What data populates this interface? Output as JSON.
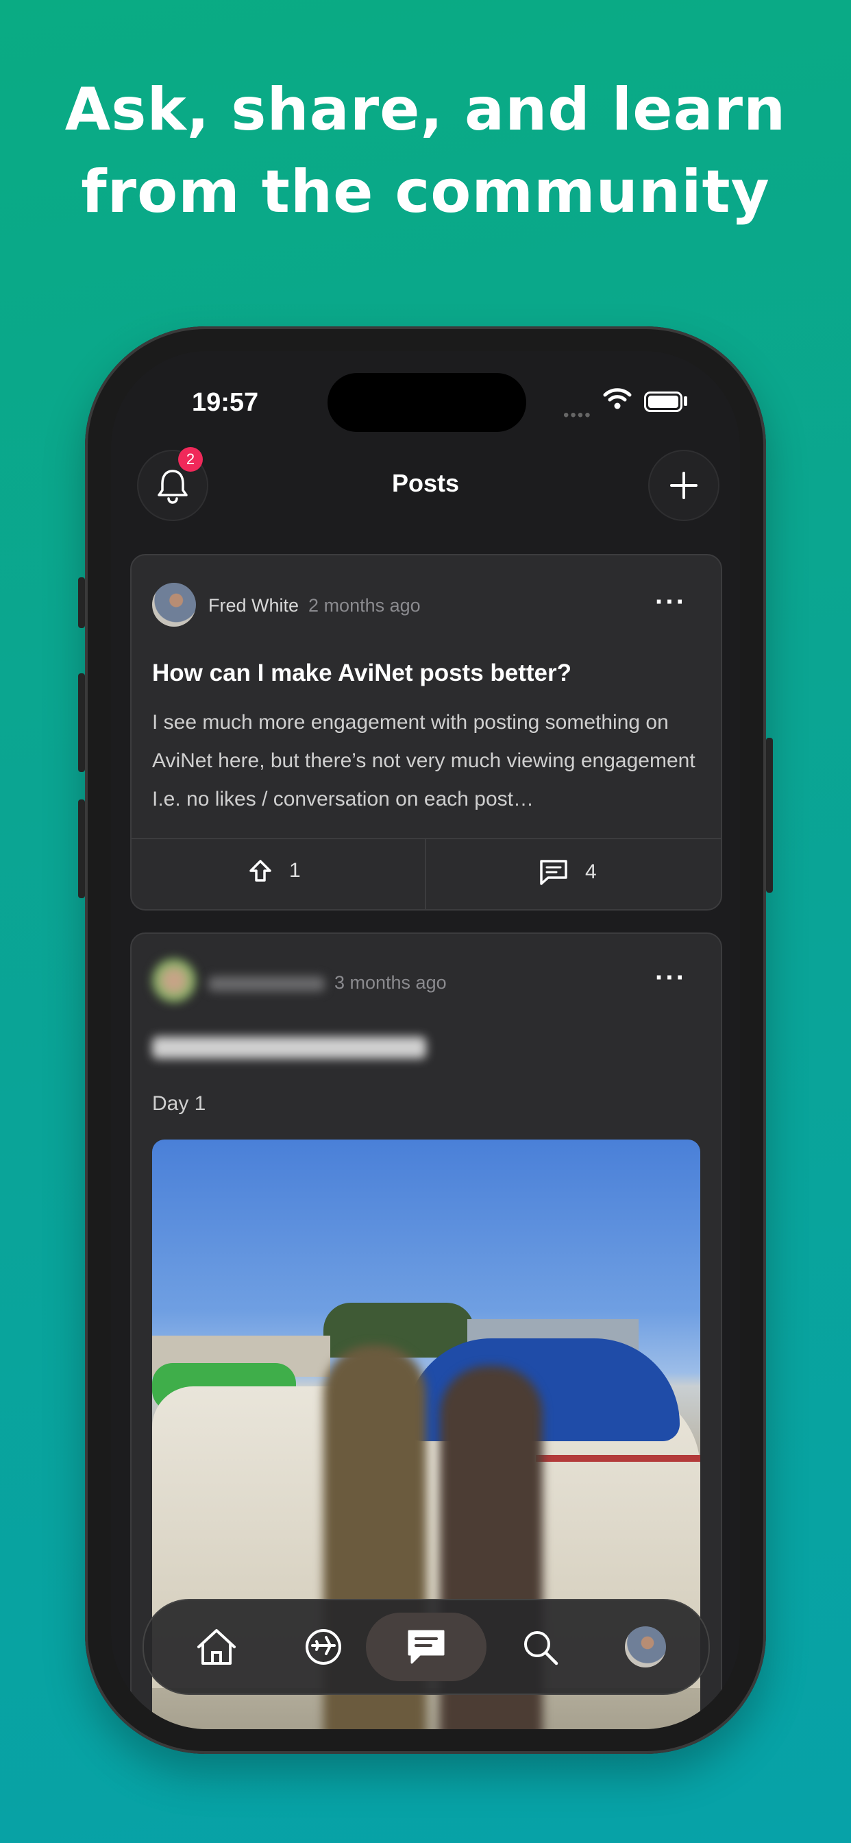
{
  "headline": {
    "line1": "Ask, share, and learn",
    "line2": "from the community"
  },
  "status_bar": {
    "time": "19:57"
  },
  "header": {
    "title": "Posts",
    "notification_count": "2"
  },
  "posts": [
    {
      "author": "Fred White",
      "time_ago": "2 months ago",
      "title": "How can I make AviNet posts better?",
      "body": "I see much more engagement with posting something on AviNet here, but there’s not very much viewing engagement I.e. no likes / conversation on each post…",
      "upvotes": "1",
      "comments": "4"
    },
    {
      "author": "",
      "time_ago": "3 months ago",
      "title": "",
      "body": "Day 1"
    }
  ],
  "tabbar": {
    "items": [
      "home-icon",
      "flight-icon",
      "posts-icon",
      "search-icon",
      "profile-avatar"
    ],
    "active": "posts-icon"
  },
  "colors": {
    "accent_badge": "#f0295a",
    "background_top": "#0aab83",
    "background_bottom": "#07a2a8",
    "card": "#2c2c2e"
  }
}
